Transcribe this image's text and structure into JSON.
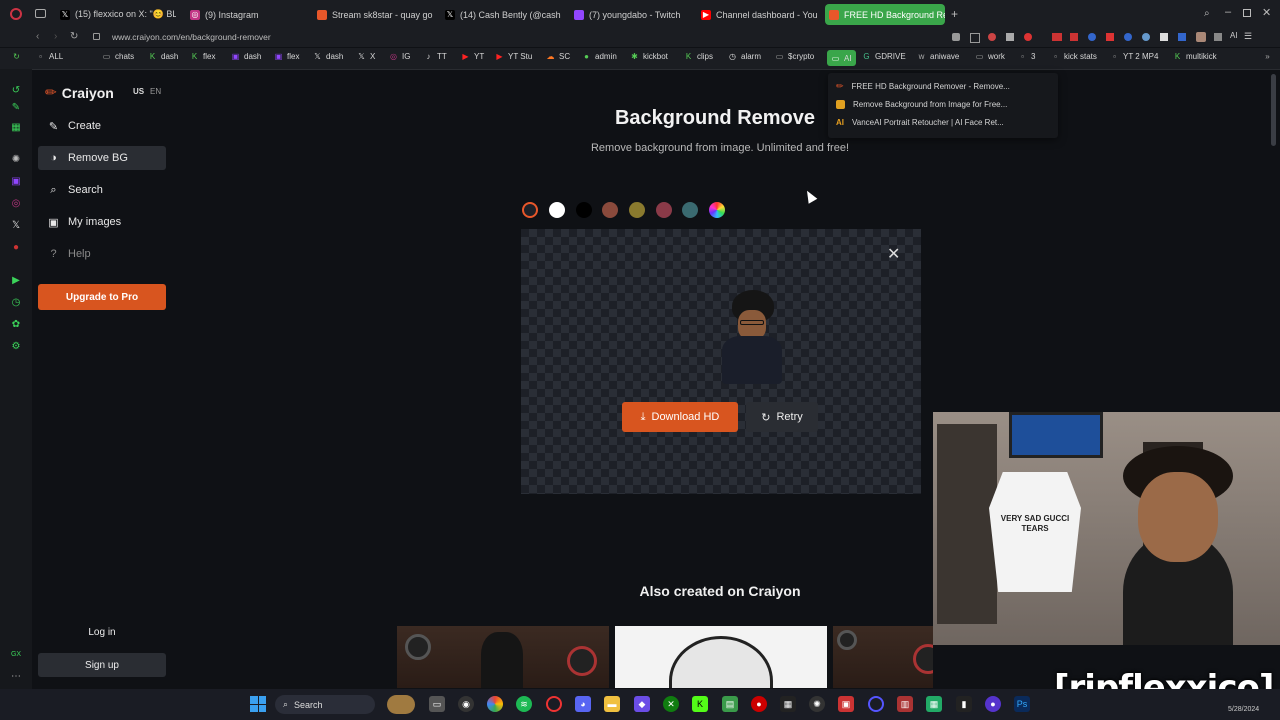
{
  "browser": {
    "tabs": [
      {
        "label": "(15) flexxico on X: \"😊 BL",
        "color": "#444"
      },
      {
        "label": "(9) Instagram",
        "color": "#c13584"
      },
      {
        "label": "Stream sk8star - quay go",
        "color": "#e8572a"
      },
      {
        "label": "(14) Cash Bently (@cashb",
        "color": "#444"
      },
      {
        "label": "(7) youngdabo - Twitch",
        "color": "#9146ff"
      },
      {
        "label": "Channel dashboard - You",
        "color": "#ff0000"
      },
      {
        "label": "FREE HD Background Rem",
        "color": "#e8572a"
      }
    ],
    "new_tab": "+",
    "url": "www.craiyon.com/en/background-remover",
    "bookmarks": [
      "ALL",
      "chats",
      "dash",
      "flex",
      "dash",
      "flex",
      "dash",
      "X",
      "IG",
      "TT",
      "YT",
      "YT Stu",
      "SC",
      "admin",
      "kickbot",
      "clips",
      "alarm",
      "$crypto",
      "AI",
      "GDRIVE",
      "aniwave",
      "work",
      "3",
      "kick stats",
      "YT 2 MP4",
      "multikick"
    ],
    "dropdown": [
      "FREE HD Background Remover - Remove...",
      "Remove Background from Image for Free...",
      "VanceAI Portrait Retoucher | AI Face Ret..."
    ]
  },
  "app": {
    "logo": "Craiyon",
    "region": "US",
    "lang": "EN",
    "nav": [
      {
        "label": "Create",
        "icon": "pencil-icon"
      },
      {
        "label": "Remove BG",
        "icon": "contrast-icon"
      },
      {
        "label": "Search",
        "icon": "search-icon"
      },
      {
        "label": "My images",
        "icon": "images-icon"
      },
      {
        "label": "Help",
        "icon": "help-icon"
      }
    ],
    "upgrade_label": "Upgrade to Pro",
    "login_label": "Log in",
    "signup_label": "Sign up"
  },
  "main": {
    "title": "Background Remove",
    "subtitle": "Remove background from image. Unlimited and free!",
    "swatches": [
      "transparent",
      "#ffffff",
      "#000000",
      "#8a4a3c",
      "#8a7a2e",
      "#8a3a48",
      "#3a6a70",
      "rainbow"
    ],
    "download_label": "Download HD",
    "retry_label": "Retry",
    "also_created": "Also created on Craiyon"
  },
  "overlay": {
    "watermark": "[ripflexxico]",
    "shirt_text": "VERY SAD GUCCI TEARS"
  },
  "taskbar": {
    "search_label": "Search",
    "date": "5/28/2024"
  }
}
